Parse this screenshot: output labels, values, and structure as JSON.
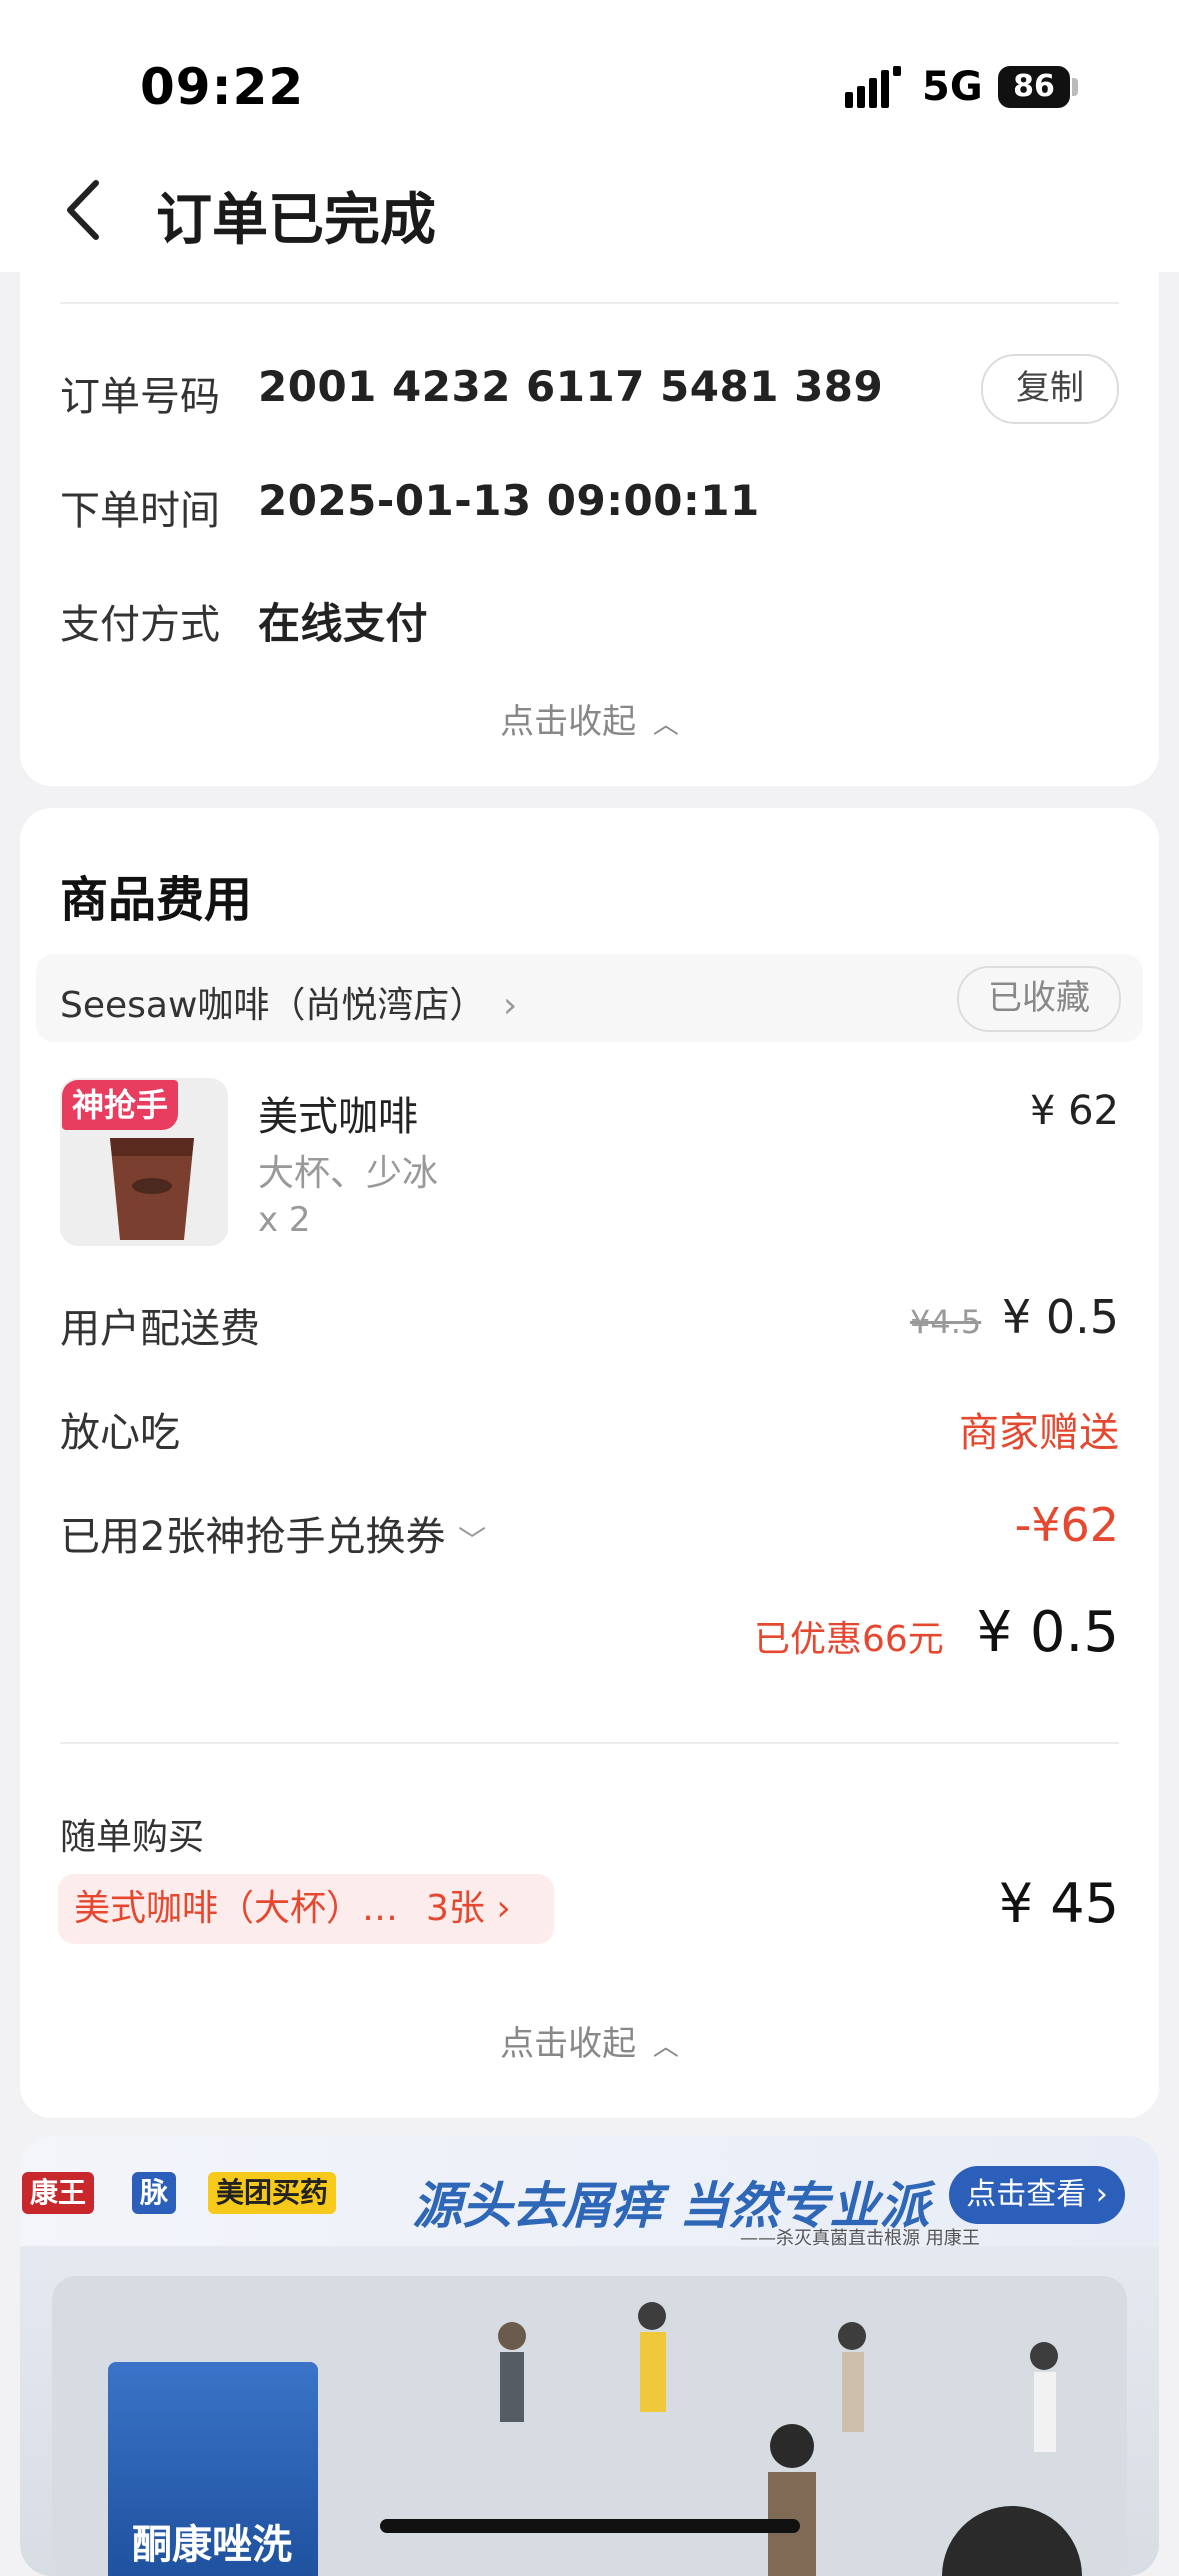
{
  "status_bar": {
    "time": "09:22",
    "network": "5G",
    "battery": "86"
  },
  "nav": {
    "title": "订单已完成"
  },
  "order_info": {
    "order_no_label": "订单号码",
    "order_no": "2001 4232 6117 5481 389",
    "copy_label": "复制",
    "time_label": "下单时间",
    "time_value": "2025-01-13 09:00:11",
    "pay_label": "支付方式",
    "pay_value": "在线支付",
    "collapse_label": "点击收起"
  },
  "fees": {
    "section_title": "商品费用",
    "store_name": "Seesaw咖啡（尚悦湾店）",
    "favorite_label": "已收藏",
    "product": {
      "tag": "神抢手",
      "name": "美式咖啡",
      "spec": "大杯、少冰",
      "qty": "x 2",
      "price": "¥ 62"
    },
    "delivery_label": "用户配送费",
    "delivery_original": "¥4.5",
    "delivery_price": "¥ 0.5",
    "assurance_label": "放心吃",
    "assurance_value": "商家赠送",
    "coupon_label": "已用2张神抢手兑换券",
    "coupon_value": "-¥62",
    "discount_note": "已优惠66元",
    "total": "¥ 0.5",
    "buy_label": "随单购买",
    "buy_item": "美式咖啡（大杯）…",
    "buy_count": "3张",
    "buy_price": "¥ 45",
    "collapse_label": "点击收起"
  },
  "ad": {
    "brand1": "康王",
    "brand2": "脉",
    "brand3": "美团买药",
    "headline": "源头去屑痒 当然专业派",
    "sub": "——杀灭真菌直击根源 用康王",
    "button": "点击查看",
    "product_name": "酮康唑洗剂"
  },
  "colors": {
    "accent_red": "#e5482f",
    "tag_pink": "#e83d5f",
    "ad_blue": "#2c5fba"
  }
}
